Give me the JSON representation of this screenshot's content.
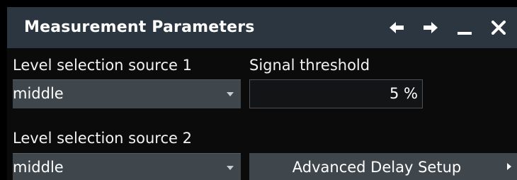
{
  "dialog": {
    "title": "Measurement Parameters",
    "icons": {
      "back": "arrow-left-icon",
      "forward": "arrow-right-icon",
      "minimize": "minimize-icon",
      "close": "close-icon"
    }
  },
  "level_source_1": {
    "label": "Level selection source 1",
    "value": "middle"
  },
  "signal_threshold": {
    "label": "Signal threshold",
    "value": "5 %"
  },
  "level_source_2": {
    "label": "Level selection source 2",
    "value": "middle"
  },
  "advanced_delay": {
    "label": "Advanced Delay Setup"
  },
  "colors": {
    "title_bar": "#2b3640",
    "control_bg": "#3f464c",
    "background": "#000000"
  }
}
